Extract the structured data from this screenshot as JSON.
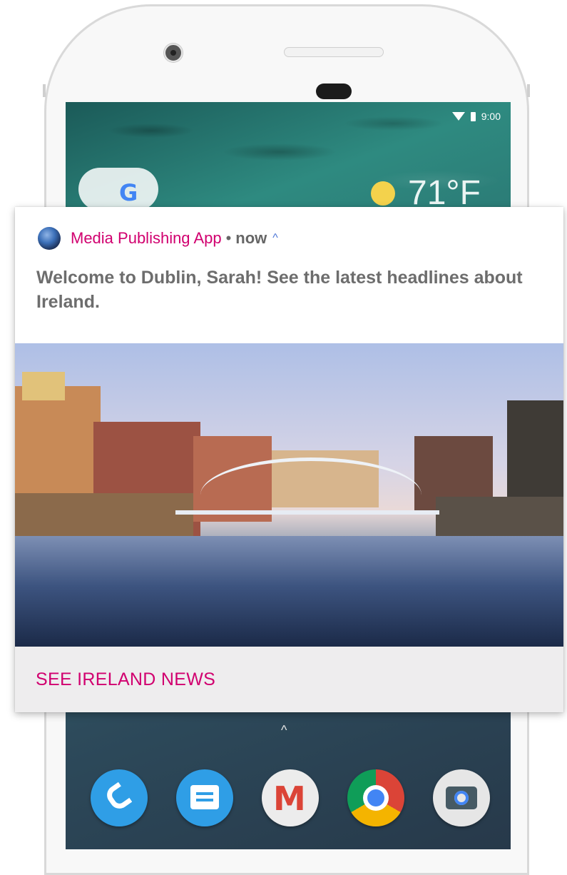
{
  "status_bar": {
    "time": "9:00"
  },
  "weather": {
    "temperature": "71°F"
  },
  "notification": {
    "app_name": "Media Publishing App",
    "separator": "•",
    "time": "now",
    "expand_chevron": "^",
    "message": "Welcome to Dublin, Sarah! See the latest headlines about Ireland.",
    "action_label": "SEE IRELAND NEWS"
  },
  "dock": {
    "apps": [
      "phone-app",
      "messages-app",
      "gmail-app",
      "chrome-app",
      "camera-app"
    ]
  },
  "colors": {
    "accent": "#d1006f",
    "chevron": "#4a74d6",
    "body_text": "#6d6d6d",
    "action_bg": "#eeedee"
  }
}
